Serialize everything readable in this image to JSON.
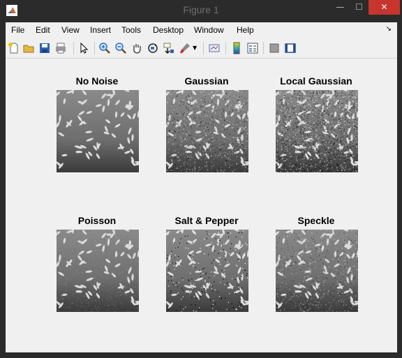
{
  "window": {
    "title": "Figure 1",
    "controls": {
      "minimize": "—",
      "maximize": "☐",
      "close": "✕"
    }
  },
  "menu": [
    "File",
    "Edit",
    "View",
    "Insert",
    "Tools",
    "Desktop",
    "Window",
    "Help"
  ],
  "toolbar": [
    "new-figure-icon",
    "open-file-icon",
    "save-icon",
    "print-icon",
    "pointer-icon",
    "zoom-in-icon",
    "zoom-out-icon",
    "pan-icon",
    "rotate-3d-icon",
    "data-cursor-icon",
    "brush-icon",
    "link-plot-icon",
    "colorbar-icon",
    "legend-icon",
    "hide-plot-tools-icon",
    "show-plot-tools-icon"
  ],
  "panels": [
    {
      "title": "No Noise",
      "noise": "none"
    },
    {
      "title": "Gaussian",
      "noise": "gaussian"
    },
    {
      "title": "Local Gaussian",
      "noise": "localvar"
    },
    {
      "title": "Poisson",
      "noise": "poisson"
    },
    {
      "title": "Salt & Pepper",
      "noise": "saltpepper"
    },
    {
      "title": "Speckle",
      "noise": "speckle"
    }
  ],
  "colors": {
    "close_button": "#c7352c",
    "canvas": "#f0f0f0",
    "titlebar": "#2b2b2b"
  }
}
